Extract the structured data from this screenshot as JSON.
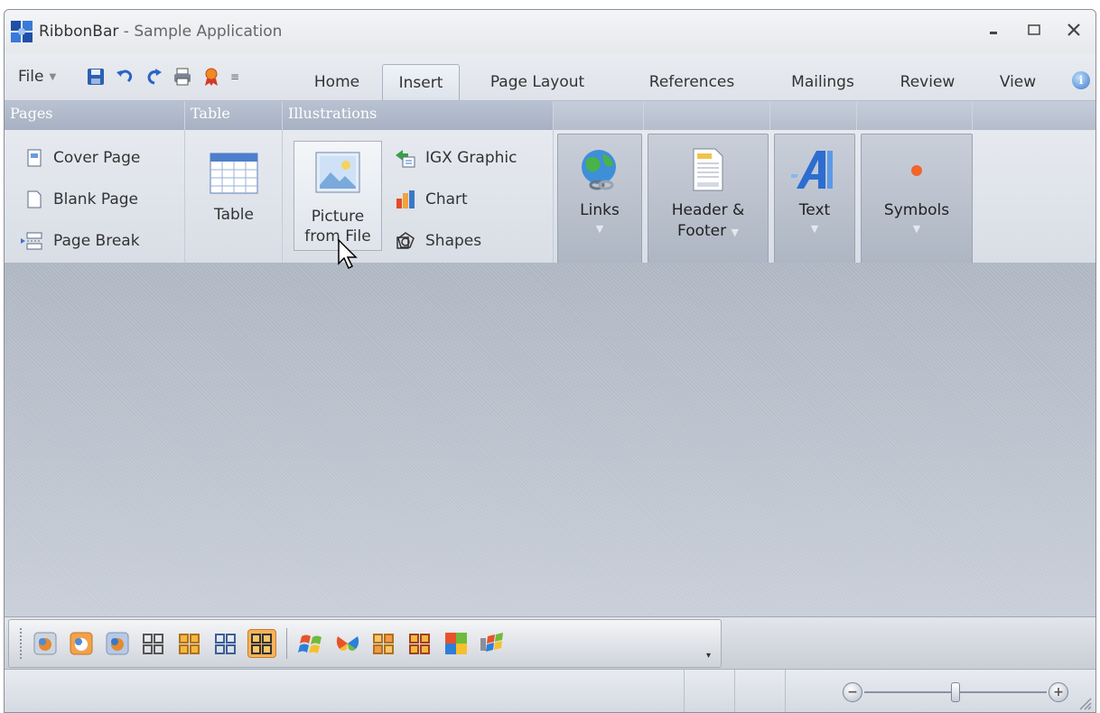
{
  "window": {
    "title": "RibbonBar",
    "subtitle": "- Sample Application",
    "minimize_icon": "minimize-icon",
    "maximize_icon": "maximize-icon",
    "close_icon": "close-icon"
  },
  "menu": {
    "file_label": "File",
    "quick_access": [
      "save-icon",
      "undo-icon",
      "redo-icon",
      "print-icon",
      "award-icon",
      "customize-qat-icon"
    ]
  },
  "tabs": [
    {
      "label": "Home",
      "active": false
    },
    {
      "label": "Insert",
      "active": true
    },
    {
      "label": "Page Layout",
      "active": false
    },
    {
      "label": "References",
      "active": false
    },
    {
      "label": "Mailings",
      "active": false
    },
    {
      "label": "Review",
      "active": false
    },
    {
      "label": "View",
      "active": false
    }
  ],
  "ribbon": {
    "groups": {
      "pages": {
        "title": "Pages",
        "items": [
          "Cover Page",
          "Blank Page",
          "Page Break"
        ]
      },
      "table": {
        "title": "Table",
        "button": "Table"
      },
      "illustrations": {
        "title": "Illustrations",
        "picture_line1": "Picture",
        "picture_line2": "from File",
        "items": [
          "IGX Graphic",
          "Chart",
          "Shapes"
        ]
      }
    },
    "large_buttons": {
      "links": "Links",
      "header_line1": "Header &",
      "header_line2": "Footer",
      "text": "Text",
      "symbols": "Symbols"
    }
  },
  "colors": {
    "accent": "#f7b25a",
    "group_header": "#b0b9ca",
    "workspace": "#b4bcc8"
  }
}
